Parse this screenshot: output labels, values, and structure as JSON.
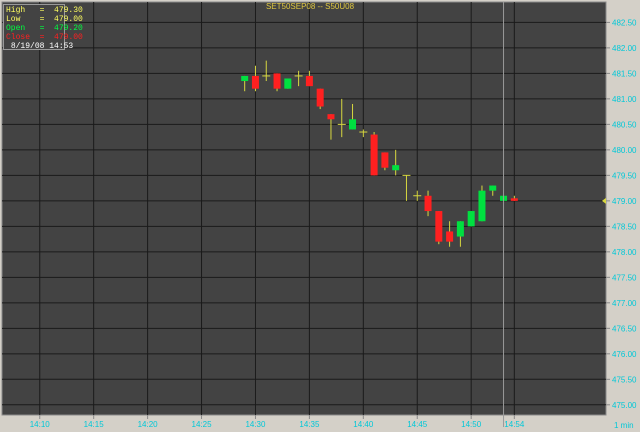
{
  "chart_data": {
    "type": "candlestick",
    "title": "SET50SEP08  --  S50U08",
    "interval_label": "1  min",
    "x_ticks": [
      "14:10",
      "14:15",
      "14:20",
      "14:25",
      "14:30",
      "14:35",
      "14:40",
      "14:45",
      "14:50",
      "14:54"
    ],
    "y_ticks": [
      "482.50",
      "482.00",
      "481.50",
      "481.00",
      "480.50",
      "480.00",
      "479.50",
      "479.00",
      "478.50",
      "478.00",
      "477.50",
      "477.00",
      "476.50",
      "476.00",
      "475.50",
      "475.00"
    ],
    "ylim": [
      474.8,
      482.9
    ],
    "x_minute_start": "14:07",
    "x_minutes_shown": 56,
    "grid": true,
    "cursor_time": "14:53",
    "last_price": 479.0,
    "info": {
      "high": "479.30",
      "low": "479.00",
      "open": "479.20",
      "close": "479.00",
      "datetime": "8/19/08  14:53"
    },
    "candles": [
      {
        "t": "14:29",
        "o": 481.35,
        "h": 481.45,
        "l": 481.15,
        "c": 481.45
      },
      {
        "t": "14:30",
        "o": 481.45,
        "h": 481.65,
        "l": 481.15,
        "c": 481.2
      },
      {
        "t": "14:31",
        "o": 481.45,
        "h": 481.75,
        "l": 481.35,
        "c": 481.45
      },
      {
        "t": "14:32",
        "o": 481.5,
        "h": 481.5,
        "l": 481.15,
        "c": 481.2
      },
      {
        "t": "14:33",
        "o": 481.2,
        "h": 481.4,
        "l": 481.2,
        "c": 481.4
      },
      {
        "t": "14:34",
        "o": 481.45,
        "h": 481.55,
        "l": 481.25,
        "c": 481.45
      },
      {
        "t": "14:35",
        "o": 481.45,
        "h": 481.55,
        "l": 481.25,
        "c": 481.25
      },
      {
        "t": "14:36",
        "o": 481.2,
        "h": 481.2,
        "l": 480.8,
        "c": 480.85
      },
      {
        "t": "14:37",
        "o": 480.7,
        "h": 480.7,
        "l": 480.2,
        "c": 480.6
      },
      {
        "t": "14:38",
        "o": 480.5,
        "h": 481.0,
        "l": 480.25,
        "c": 480.5
      },
      {
        "t": "14:39",
        "o": 480.4,
        "h": 480.9,
        "l": 480.4,
        "c": 480.6
      },
      {
        "t": "14:40",
        "o": 480.35,
        "h": 480.4,
        "l": 480.25,
        "c": 480.35
      },
      {
        "t": "14:41",
        "o": 480.3,
        "h": 480.35,
        "l": 479.5,
        "c": 479.5
      },
      {
        "t": "14:42",
        "o": 479.95,
        "h": 479.95,
        "l": 479.6,
        "c": 479.65
      },
      {
        "t": "14:43",
        "o": 479.6,
        "h": 480.0,
        "l": 479.5,
        "c": 479.7
      },
      {
        "t": "14:44",
        "o": 479.5,
        "h": 479.5,
        "l": 479.0,
        "c": 479.5
      },
      {
        "t": "14:45",
        "o": 479.1,
        "h": 479.2,
        "l": 479.0,
        "c": 479.1
      },
      {
        "t": "14:46",
        "o": 479.1,
        "h": 479.2,
        "l": 478.7,
        "c": 478.8
      },
      {
        "t": "14:47",
        "o": 478.8,
        "h": 478.8,
        "l": 478.15,
        "c": 478.2
      },
      {
        "t": "14:48",
        "o": 478.4,
        "h": 478.6,
        "l": 478.1,
        "c": 478.2
      },
      {
        "t": "14:49",
        "o": 478.3,
        "h": 478.6,
        "l": 478.1,
        "c": 478.6
      },
      {
        "t": "14:50",
        "o": 478.5,
        "h": 478.8,
        "l": 478.5,
        "c": 478.8
      },
      {
        "t": "14:51",
        "o": 478.6,
        "h": 479.3,
        "l": 478.6,
        "c": 479.2
      },
      {
        "t": "14:52",
        "o": 479.2,
        "h": 479.3,
        "l": 479.1,
        "c": 479.3
      },
      {
        "t": "14:53",
        "o": 479.0,
        "h": 479.1,
        "l": 479.0,
        "c": 479.1
      },
      {
        "t": "14:54",
        "o": 479.05,
        "h": 479.1,
        "l": 479.0,
        "c": 479.0
      }
    ]
  },
  "labels": {
    "high": "High",
    "low": "Low",
    "open": "Open",
    "close": "Close",
    "eq": "="
  },
  "colors": {
    "up": "#00e040",
    "down": "#ff2020",
    "wick": "#d8d840",
    "plot_bg": "#434343",
    "grid": "#1a1a1a",
    "axis_text": "#00c8d8",
    "title": "#e0c840",
    "info_high": "#ffff60",
    "info_low": "#ffff60",
    "info_open": "#00ff40",
    "info_close": "#ff2020",
    "info_date": "#ffffff"
  }
}
